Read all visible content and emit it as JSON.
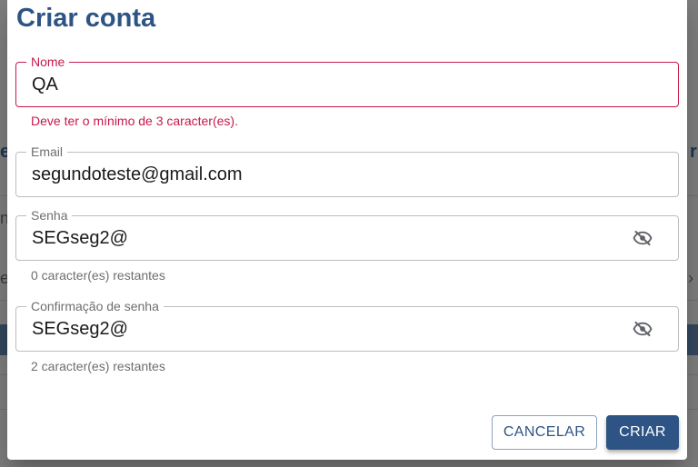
{
  "dialog": {
    "title": "Criar conta",
    "fields": {
      "name": {
        "label": "Nome",
        "value": "QA",
        "error": "Deve ter o mínimo de 3 caracter(es)."
      },
      "email": {
        "label": "Email",
        "value": "segundoteste@gmail.com"
      },
      "password": {
        "label": "Senha",
        "value": "SEGseg2@",
        "hint": "0 caracter(es) restantes",
        "toggle_icon": "eye-off-icon"
      },
      "confirm": {
        "label": "Confirmação de senha",
        "value": "SEGseg2@",
        "hint": "2 caracter(es) restantes",
        "toggle_icon": "eye-off-icon"
      }
    },
    "buttons": {
      "cancel": "CANCELAR",
      "create": "CRIAR"
    }
  },
  "colors": {
    "primary": "#2d5484",
    "error": "#c7194a",
    "hint": "#6e6e6e"
  }
}
